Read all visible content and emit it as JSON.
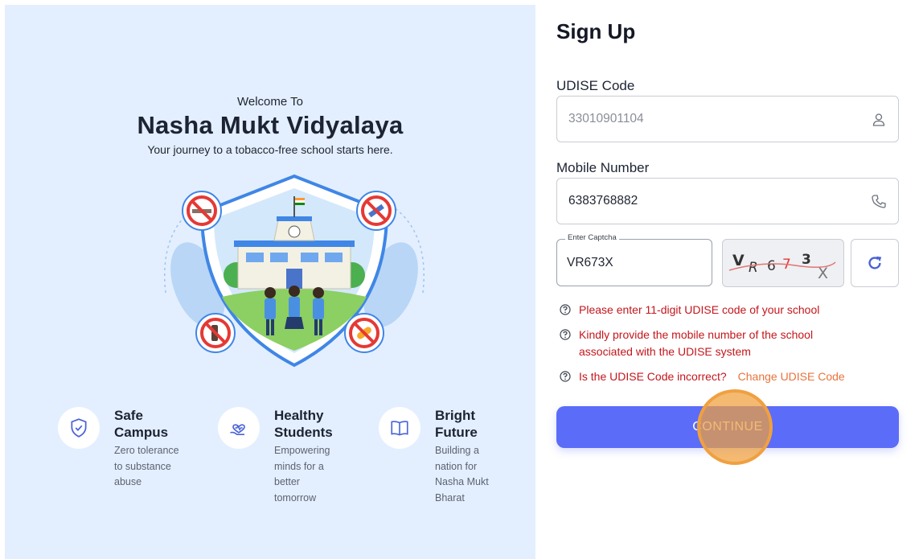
{
  "left": {
    "welcome": "Welcome To",
    "title": "Nasha Mukt Vidyalaya",
    "tagline": "Your journey to a tobacco-free school starts here.",
    "features": [
      {
        "title_line1": "Safe",
        "title_line2": "Campus",
        "desc": [
          "Zero tolerance",
          "to substance",
          "abuse"
        ],
        "icon": "shield-check-icon"
      },
      {
        "title_line1": "Healthy",
        "title_line2": "Students",
        "desc": [
          "Empowering",
          "minds for a",
          "better",
          "tomorrow"
        ],
        "icon": "heart-hand-icon"
      },
      {
        "title_line1": "Bright",
        "title_line2": "Future",
        "desc": [
          "Building a",
          "nation for",
          "Nasha Mukt",
          "Bharat"
        ],
        "icon": "book-icon"
      }
    ]
  },
  "form": {
    "title": "Sign Up",
    "udise_label": "UDISE Code",
    "udise_value": "33010901104",
    "mobile_label": "Mobile Number",
    "mobile_value": "6383768882",
    "captcha_legend": "Enter Captcha",
    "captcha_value": "VR673X",
    "captcha_chars": [
      "V",
      "R",
      "6",
      "7",
      "3",
      "X"
    ],
    "hints": [
      "Please enter 11-digit UDISE code of your school",
      "Kindly provide the mobile number of the school",
      "associated with the UDISE system",
      "Is the UDISE Code incorrect?"
    ],
    "change_link": "Change UDISE Code",
    "continue_label": "CONTINUE"
  },
  "colors": {
    "primary": "#5b6cf9",
    "error": "#c4161c",
    "link": "#e8743b",
    "left_bg": "#e3efff"
  }
}
